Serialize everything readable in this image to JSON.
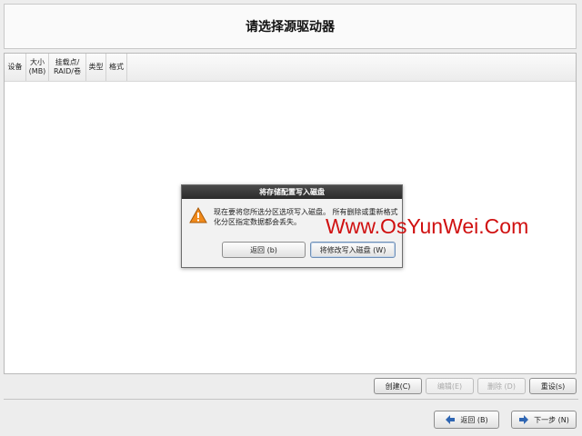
{
  "header": {
    "title": "请选择源驱动器"
  },
  "table": {
    "columns": [
      "设备",
      "大小\n(MB)",
      "挂载点/\nRAID/卷",
      "类型",
      "格式"
    ]
  },
  "dialog": {
    "title": "将存储配置写入磁盘",
    "message": "现在要将您所选分区选项写入磁盘。 所有删除或重新格式化分区指定数据都会丢失。",
    "buttons": {
      "back": "返回 (b)",
      "write": "将修改写入磁盘 (W)"
    },
    "icon": "warning-icon"
  },
  "watermark": "Www.OsYunWei.Com",
  "toolbar": {
    "create": "创建(C)",
    "edit": "编辑(E)",
    "delete": "删除 (D)",
    "reset": "重设(s)"
  },
  "nav": {
    "back": "返回 (B)",
    "next": "下一步 (N)"
  },
  "colors": {
    "warning": "#f08a1c",
    "nav_arrow": "#2f66b3",
    "watermark": "#d01010"
  }
}
